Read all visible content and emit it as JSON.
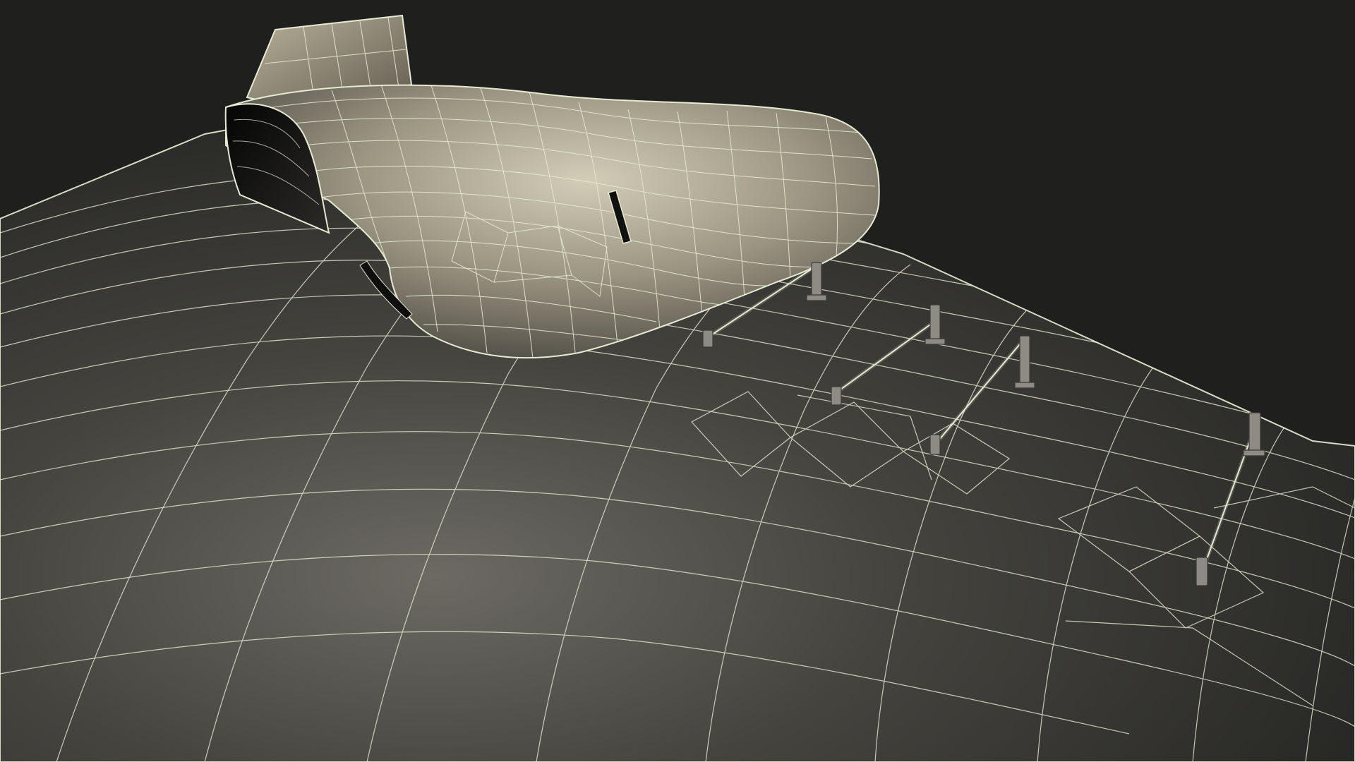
{
  "scene": {
    "subject": "3d-wireframe-render",
    "shading": "solid-with-wireframe-overlay",
    "colors": {
      "background": "#1f1f1e",
      "hull_light": "#6c6a63",
      "hull_dark": "#262624",
      "hull_mid": "#3d3c38",
      "cowl_light": "#d2cdb7",
      "cowl_mid": "#9b9582",
      "cowl_dark": "#4b4942",
      "fin_light": "#b9b29b",
      "fin_dark": "#5f5b4f",
      "wire": "#e6ead2",
      "wire_soft": "#bfc4ad",
      "bracket": "#8d8b83",
      "bracket_dark": "#3c3b37"
    },
    "parts": [
      "hull-surface",
      "engine-cowl",
      "tail-fin",
      "air-intake",
      "side-vent",
      "handrail-rods",
      "mounting-brackets"
    ]
  }
}
